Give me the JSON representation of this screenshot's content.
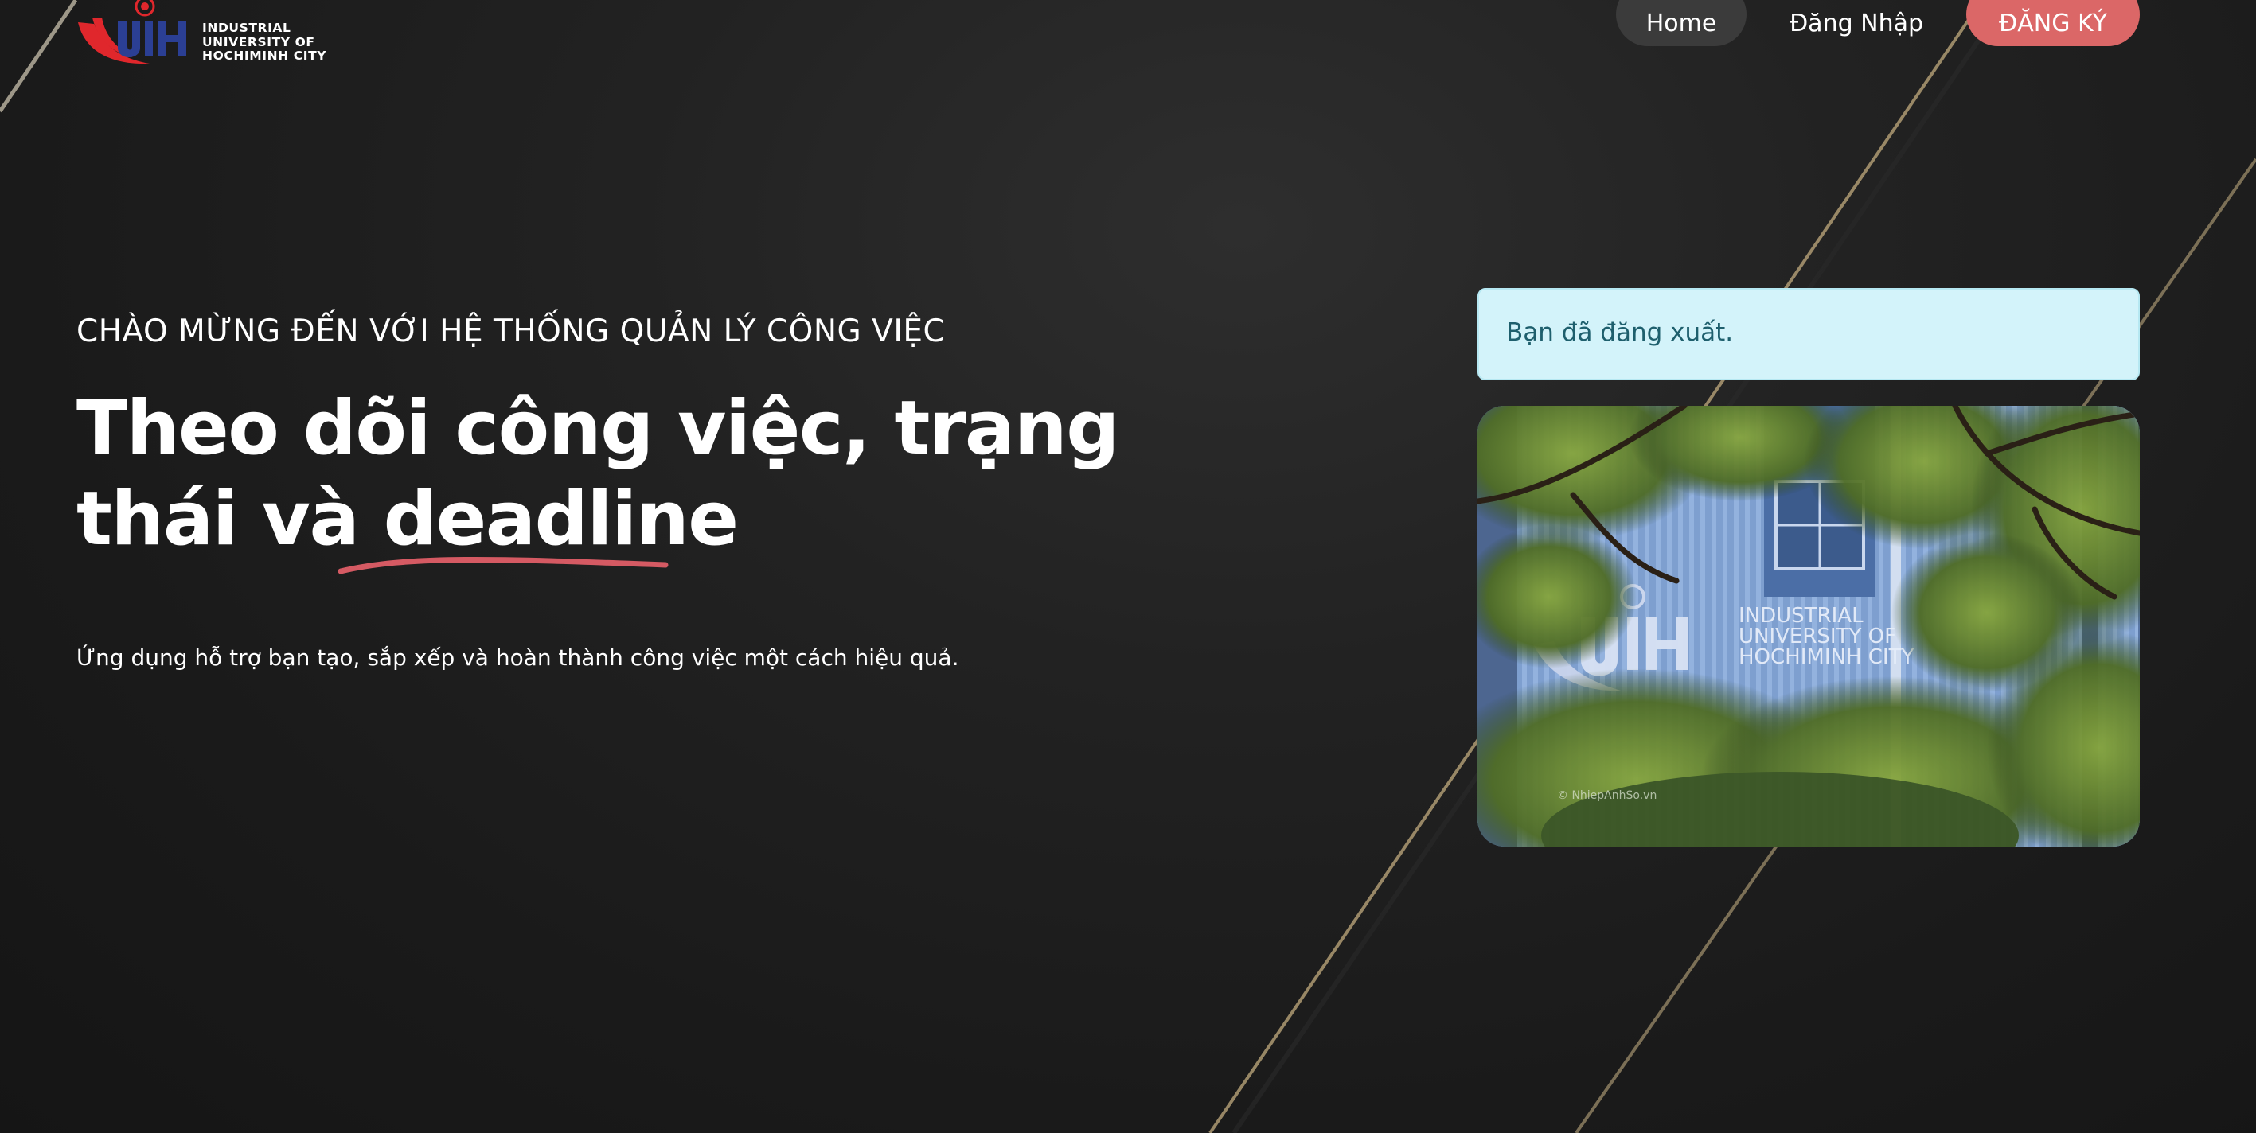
{
  "header": {
    "logo": {
      "monogram": "UIH",
      "text_lines": [
        "INDUSTRIAL",
        "UNIVERSITY OF",
        "HOCHIMINH CITY"
      ]
    },
    "nav": {
      "home_label": "Home",
      "login_label": "Đăng Nhập",
      "register_label": "ĐĂNG KÝ"
    }
  },
  "hero": {
    "eyebrow": "CHÀO MỪNG ĐẾN VỚI HỆ THỐNG QUẢN LÝ CÔNG VIỆC",
    "headline_line1": "Theo dõi công việc, trạng",
    "headline_line2_prefix": "thái và ",
    "headline_highlight": "deadline",
    "subtitle": "Ứng dụng hỗ trợ bạn tạo, sắp xếp và hoàn thành công việc một cách hiệu quả."
  },
  "alert": {
    "message": "Bạn đã đăng xuất."
  },
  "campus_image": {
    "sign_lines": [
      "INDUSTRIAL",
      "UNIVERSITY OF",
      "HOCHIMINH CITY"
    ],
    "watermark": "© NhiepAnhSo.vn"
  },
  "colors": {
    "background": "#1c1c1c",
    "accent": "#db6767",
    "alert_bg": "#d3f3fa",
    "alert_text": "#1e5f6d",
    "logo_red": "#e0272c",
    "logo_blue": "#2b3f94"
  }
}
